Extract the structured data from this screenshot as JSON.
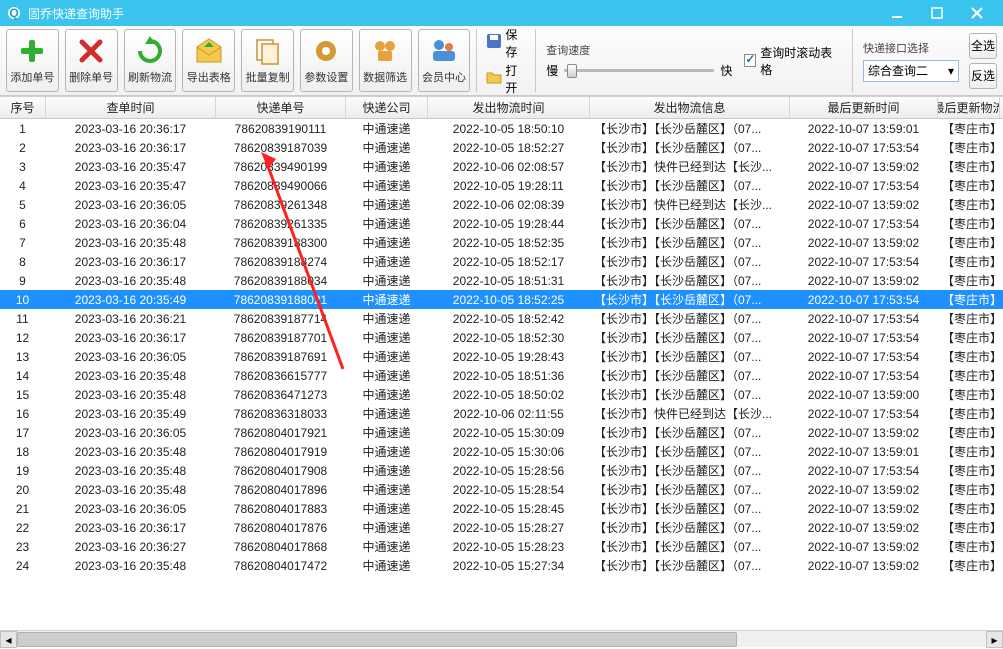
{
  "window": {
    "title": "固乔快递查询助手",
    "min": "—",
    "max": "□",
    "close": "✕"
  },
  "toolbar": {
    "add": "添加单号",
    "delete": "删除单号",
    "refresh": "刷新物流",
    "export": "导出表格",
    "copy": "批量复制",
    "settings": "参数设置",
    "filter": "数据筛选",
    "member": "会员中心",
    "save": "保存",
    "open": "打开"
  },
  "speed": {
    "title": "查询速度",
    "slow": "慢",
    "fast": "快",
    "scroll_check": "查询时滚动表格"
  },
  "api": {
    "title": "快递接口选择",
    "value": "综合查询二"
  },
  "side": {
    "all": "全选",
    "inv": "反选"
  },
  "cols": {
    "seq": "序号",
    "time": "查单时间",
    "num": "快递单号",
    "comp": "快递公司",
    "send": "发出物流时间",
    "info": "发出物流信息",
    "upd": "最后更新时间",
    "last": "最后更新物流"
  },
  "company": "中通速递",
  "info_a": "【长沙市】【长沙岳麓区】（07...",
  "info_b": "【长沙市】快件已经到达【长沙...",
  "last_cell": "【枣庄市】忄",
  "rows": [
    {
      "seq": "1",
      "time": "2023-03-16 20:36:17",
      "num": "78620839190111",
      "send": "2022-10-05 18:50:10",
      "info": "a",
      "upd": "2022-10-07 13:59:01"
    },
    {
      "seq": "2",
      "time": "2023-03-16 20:36:17",
      "num": "78620839187039",
      "send": "2022-10-05 18:52:27",
      "info": "a",
      "upd": "2022-10-07 17:53:54"
    },
    {
      "seq": "3",
      "time": "2023-03-16 20:35:47",
      "num": "78620839490199",
      "send": "2022-10-06 02:08:57",
      "info": "b",
      "upd": "2022-10-07 13:59:02"
    },
    {
      "seq": "4",
      "time": "2023-03-16 20:35:47",
      "num": "78620839490066",
      "send": "2022-10-05 19:28:11",
      "info": "a",
      "upd": "2022-10-07 17:53:54"
    },
    {
      "seq": "5",
      "time": "2023-03-16 20:36:05",
      "num": "78620839261348",
      "send": "2022-10-06 02:08:39",
      "info": "b",
      "upd": "2022-10-07 13:59:02"
    },
    {
      "seq": "6",
      "time": "2023-03-16 20:36:04",
      "num": "78620839261335",
      "send": "2022-10-05 19:28:44",
      "info": "a",
      "upd": "2022-10-07 17:53:54"
    },
    {
      "seq": "7",
      "time": "2023-03-16 20:35:48",
      "num": "78620839188300",
      "send": "2022-10-05 18:52:35",
      "info": "a",
      "upd": "2022-10-07 13:59:02"
    },
    {
      "seq": "8",
      "time": "2023-03-16 20:36:17",
      "num": "78620839188274",
      "send": "2022-10-05 18:52:17",
      "info": "a",
      "upd": "2022-10-07 17:53:54"
    },
    {
      "seq": "9",
      "time": "2023-03-16 20:35:48",
      "num": "78620839188034",
      "send": "2022-10-05 18:51:31",
      "info": "a",
      "upd": "2022-10-07 13:59:02"
    },
    {
      "seq": "10",
      "time": "2023-03-16 20:35:49",
      "num": "78620839188021",
      "send": "2022-10-05 18:52:25",
      "info": "a",
      "upd": "2022-10-07 17:53:54",
      "sel": true
    },
    {
      "seq": "11",
      "time": "2023-03-16 20:36:21",
      "num": "78620839187714",
      "send": "2022-10-05 18:52:42",
      "info": "a",
      "upd": "2022-10-07 17:53:54"
    },
    {
      "seq": "12",
      "time": "2023-03-16 20:36:17",
      "num": "78620839187701",
      "send": "2022-10-05 18:52:30",
      "info": "a",
      "upd": "2022-10-07 17:53:54"
    },
    {
      "seq": "13",
      "time": "2023-03-16 20:36:05",
      "num": "78620839187691",
      "send": "2022-10-05 19:28:43",
      "info": "a",
      "upd": "2022-10-07 17:53:54"
    },
    {
      "seq": "14",
      "time": "2023-03-16 20:35:48",
      "num": "78620836615777",
      "send": "2022-10-05 18:51:36",
      "info": "a",
      "upd": "2022-10-07 17:53:54"
    },
    {
      "seq": "15",
      "time": "2023-03-16 20:35:48",
      "num": "78620836471273",
      "send": "2022-10-05 18:50:02",
      "info": "a",
      "upd": "2022-10-07 13:59:00"
    },
    {
      "seq": "16",
      "time": "2023-03-16 20:35:49",
      "num": "78620836318033",
      "send": "2022-10-06 02:11:55",
      "info": "b",
      "upd": "2022-10-07 17:53:54"
    },
    {
      "seq": "17",
      "time": "2023-03-16 20:36:05",
      "num": "78620804017921",
      "send": "2022-10-05 15:30:09",
      "info": "a",
      "upd": "2022-10-07 13:59:02"
    },
    {
      "seq": "18",
      "time": "2023-03-16 20:35:48",
      "num": "78620804017919",
      "send": "2022-10-05 15:30:06",
      "info": "a",
      "upd": "2022-10-07 13:59:01"
    },
    {
      "seq": "19",
      "time": "2023-03-16 20:35:48",
      "num": "78620804017908",
      "send": "2022-10-05 15:28:56",
      "info": "a",
      "upd": "2022-10-07 17:53:54"
    },
    {
      "seq": "20",
      "time": "2023-03-16 20:35:48",
      "num": "78620804017896",
      "send": "2022-10-05 15:28:54",
      "info": "a",
      "upd": "2022-10-07 13:59:02"
    },
    {
      "seq": "21",
      "time": "2023-03-16 20:36:05",
      "num": "78620804017883",
      "send": "2022-10-05 15:28:45",
      "info": "a",
      "upd": "2022-10-07 13:59:02"
    },
    {
      "seq": "22",
      "time": "2023-03-16 20:36:17",
      "num": "78620804017876",
      "send": "2022-10-05 15:28:27",
      "info": "a",
      "upd": "2022-10-07 13:59:02"
    },
    {
      "seq": "23",
      "time": "2023-03-16 20:36:27",
      "num": "78620804017868",
      "send": "2022-10-05 15:28:23",
      "info": "a",
      "upd": "2022-10-07 13:59:02"
    },
    {
      "seq": "24",
      "time": "2023-03-16 20:35:48",
      "num": "78620804017472",
      "send": "2022-10-05 15:27:34",
      "info": "a",
      "upd": "2022-10-07 13:59:02"
    }
  ]
}
